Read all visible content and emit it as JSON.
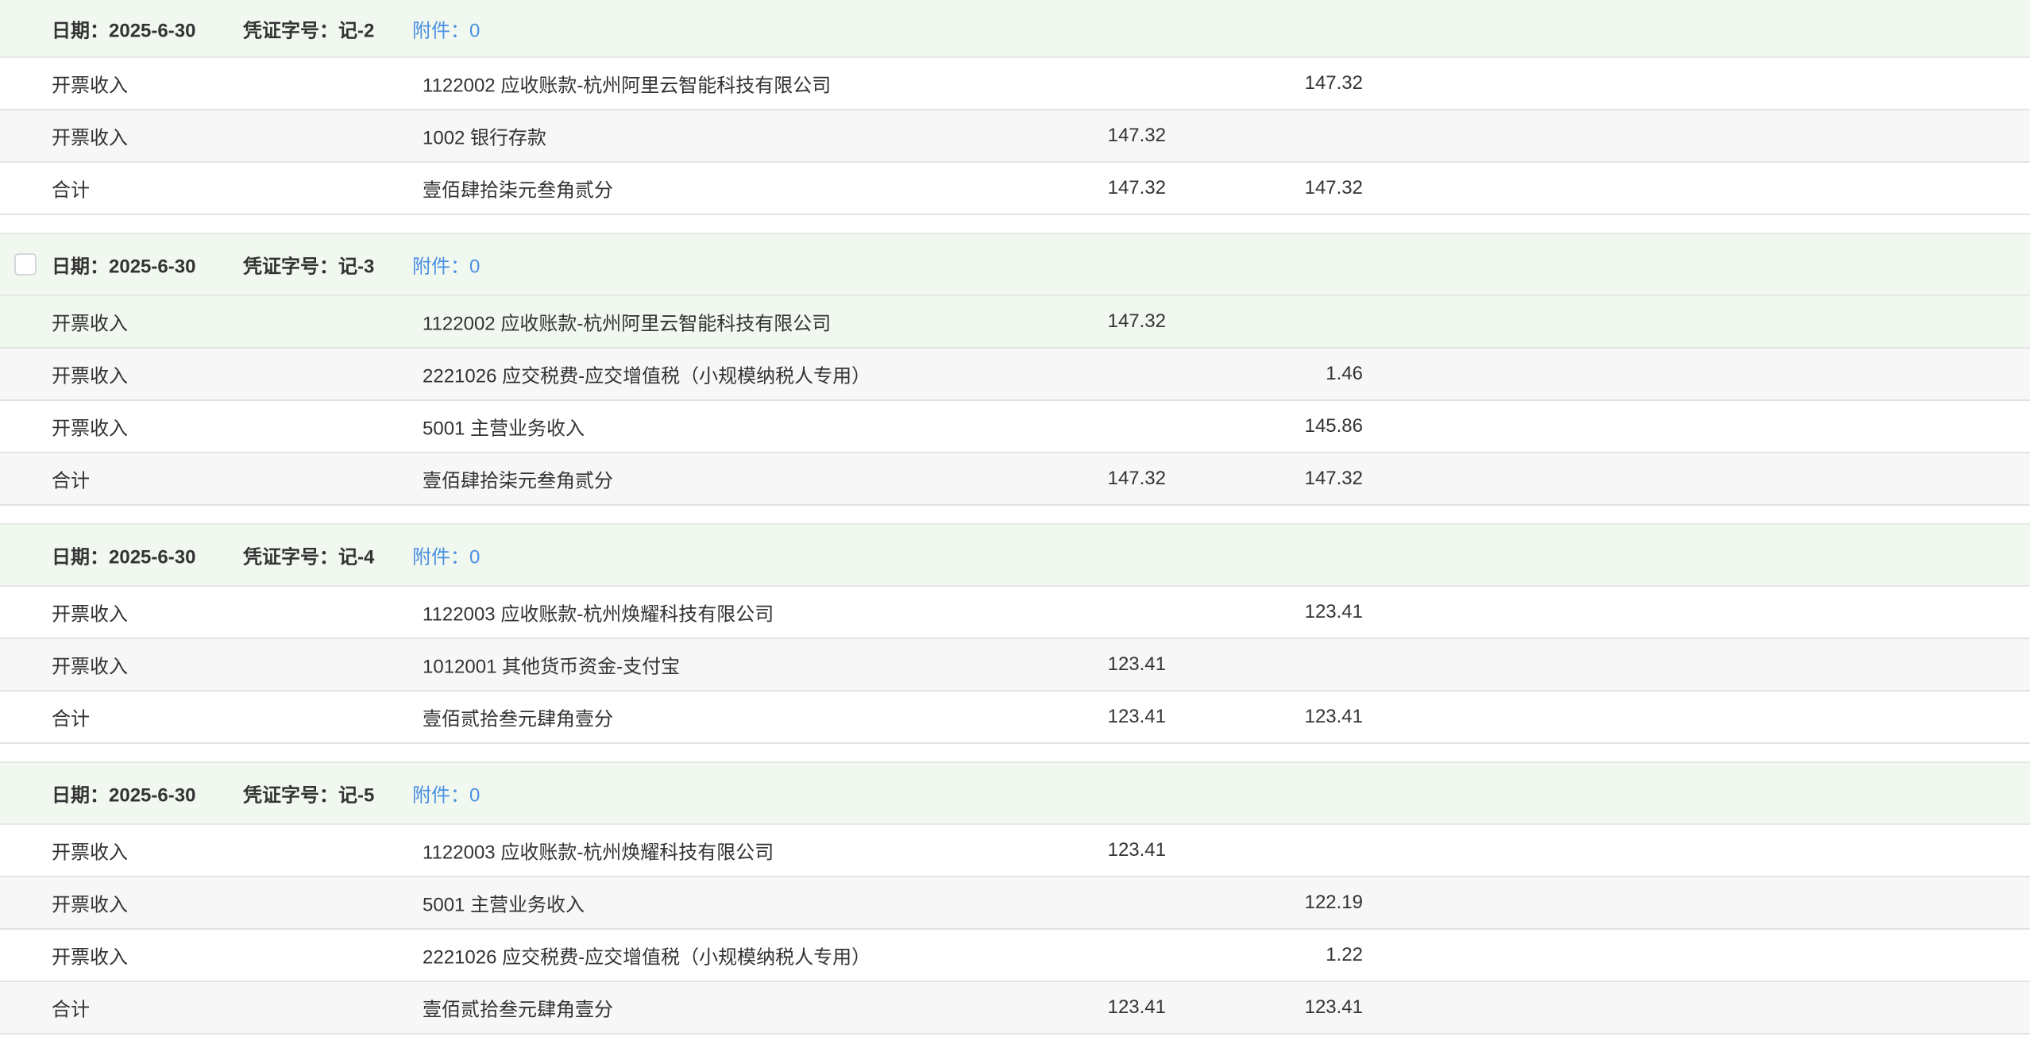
{
  "labels": {
    "date_prefix": "日期：",
    "voucher_prefix": "凭证字号：",
    "attachment_prefix": "附件："
  },
  "colors": {
    "header_bg": "#f1f8f0",
    "link": "#4a90e2",
    "alt_row": "#f7f7f7"
  },
  "vouchers": [
    {
      "date": "2025-6-30",
      "voucher_no": "记-2",
      "attachments": "0",
      "has_checkbox": false,
      "rows": [
        {
          "summary": "开票收入",
          "account": "1122002 应收账款-杭州阿里云智能科技有限公司",
          "debit": "",
          "credit": "147.32",
          "style": ""
        },
        {
          "summary": "开票收入",
          "account": "1002 银行存款",
          "debit": "147.32",
          "credit": "",
          "style": "alt"
        },
        {
          "summary": "合计",
          "account": "壹佰肆拾柒元叁角贰分",
          "debit": "147.32",
          "credit": "147.32",
          "style": ""
        }
      ]
    },
    {
      "date": "2025-6-30",
      "voucher_no": "记-3",
      "attachments": "0",
      "has_checkbox": true,
      "rows": [
        {
          "summary": "开票收入",
          "account": "1122002 应收账款-杭州阿里云智能科技有限公司",
          "debit": "147.32",
          "credit": "",
          "style": "hl"
        },
        {
          "summary": "开票收入",
          "account": "2221026 应交税费-应交增值税（小规模纳税人专用）",
          "debit": "",
          "credit": "1.46",
          "style": "alt"
        },
        {
          "summary": "开票收入",
          "account": "5001 主营业务收入",
          "debit": "",
          "credit": "145.86",
          "style": ""
        },
        {
          "summary": "合计",
          "account": "壹佰肆拾柒元叁角贰分",
          "debit": "147.32",
          "credit": "147.32",
          "style": "alt"
        }
      ]
    },
    {
      "date": "2025-6-30",
      "voucher_no": "记-4",
      "attachments": "0",
      "has_checkbox": false,
      "rows": [
        {
          "summary": "开票收入",
          "account": "1122003 应收账款-杭州焕耀科技有限公司",
          "debit": "",
          "credit": "123.41",
          "style": ""
        },
        {
          "summary": "开票收入",
          "account": "1012001 其他货币资金-支付宝",
          "debit": "123.41",
          "credit": "",
          "style": "alt"
        },
        {
          "summary": "合计",
          "account": "壹佰贰拾叁元肆角壹分",
          "debit": "123.41",
          "credit": "123.41",
          "style": ""
        }
      ]
    },
    {
      "date": "2025-6-30",
      "voucher_no": "记-5",
      "attachments": "0",
      "has_checkbox": false,
      "rows": [
        {
          "summary": "开票收入",
          "account": "1122003 应收账款-杭州焕耀科技有限公司",
          "debit": "123.41",
          "credit": "",
          "style": ""
        },
        {
          "summary": "开票收入",
          "account": "5001 主营业务收入",
          "debit": "",
          "credit": "122.19",
          "style": "alt"
        },
        {
          "summary": "开票收入",
          "account": "2221026 应交税费-应交增值税（小规模纳税人专用）",
          "debit": "",
          "credit": "1.22",
          "style": ""
        },
        {
          "summary": "合计",
          "account": "壹佰贰拾叁元肆角壹分",
          "debit": "123.41",
          "credit": "123.41",
          "style": "alt"
        }
      ]
    }
  ]
}
